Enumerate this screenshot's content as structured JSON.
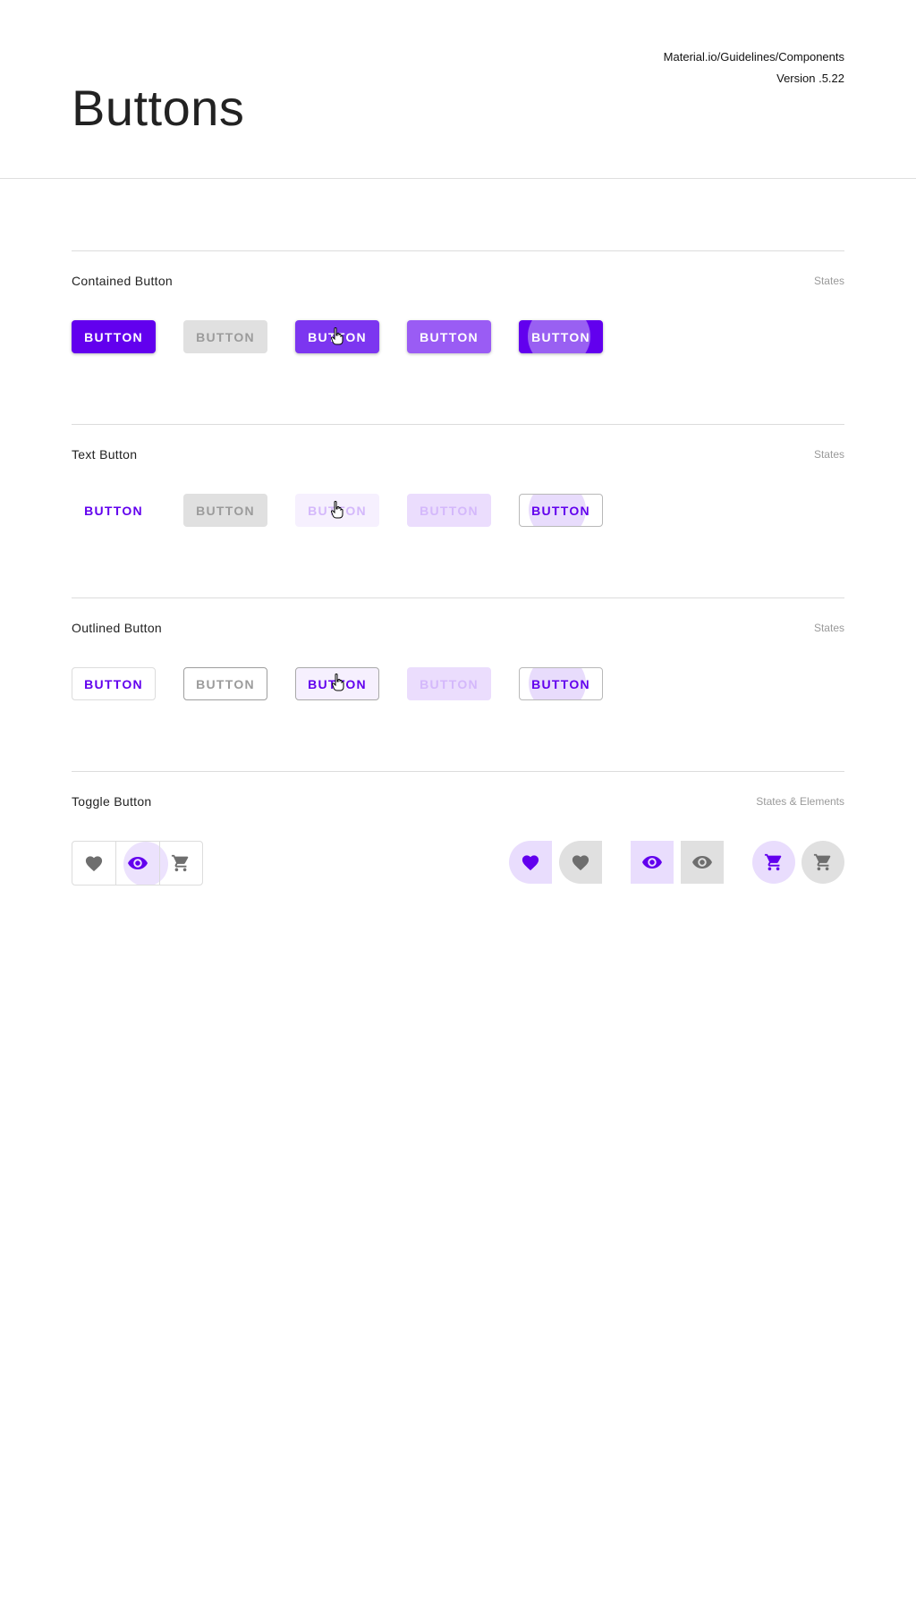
{
  "header": {
    "title": "Buttons",
    "meta_line1": "Material.io/Guidelines/Components",
    "meta_line2": "Version .5.22"
  },
  "colors": {
    "primary": "#6200ee",
    "hover": "#7c36f0",
    "focused": "#9a5cf4",
    "disabled_bg": "#e0e0e0",
    "disabled_text": "#9b9b9b",
    "lavender": "#e9ddfd"
  },
  "sections": {
    "contained": {
      "title": "Contained Button",
      "states": "States",
      "buttons": [
        "BUTTON",
        "BUTTON",
        "BUTTON",
        "BUTTON",
        "BUTTON"
      ]
    },
    "text": {
      "title": "Text Button",
      "states": "States",
      "buttons": [
        "BUTTON",
        "BUTTON",
        "BUTTON",
        "BUTTON",
        "BUTTON"
      ]
    },
    "outlined": {
      "title": "Outlined Button",
      "states": "States",
      "buttons": [
        "BUTTON",
        "BUTTON",
        "BUTTON",
        "BUTTON",
        "BUTTON"
      ]
    },
    "toggle": {
      "title": "Toggle Button",
      "states": "States & Elements",
      "group_icons": [
        "heart-icon",
        "eye-icon",
        "cart-icon"
      ],
      "pair_icons": [
        "heart-icon",
        "eye-icon",
        "cart-icon"
      ]
    }
  },
  "cursor_icon": "hand-pointer-icon"
}
